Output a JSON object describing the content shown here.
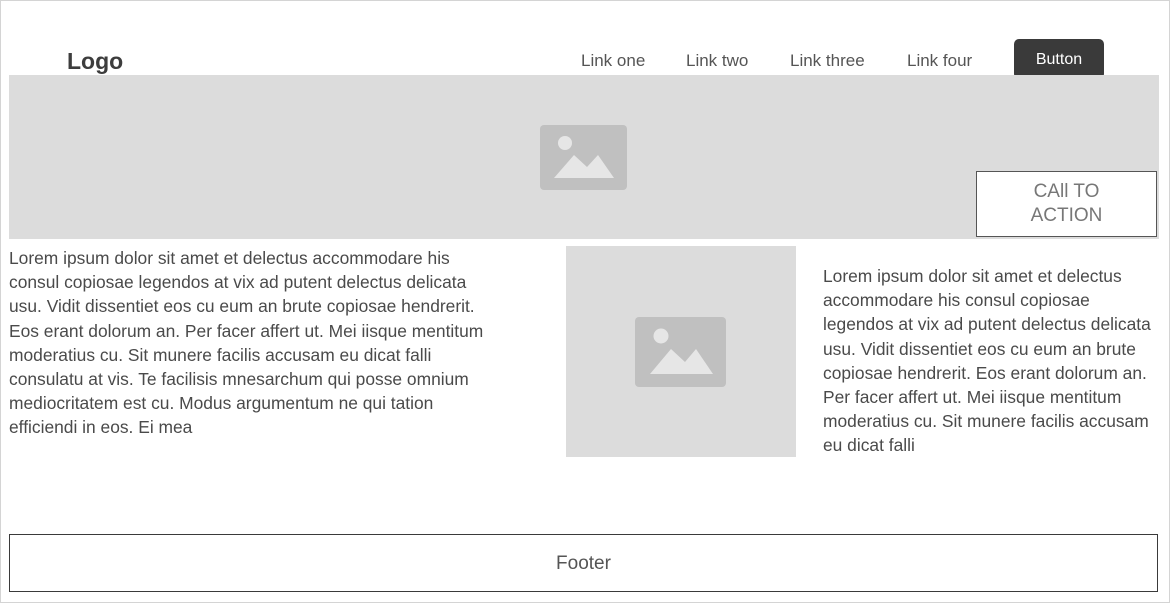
{
  "header": {
    "logo": "Logo",
    "nav": [
      "Link one",
      "Link two",
      "Link three",
      "Link four"
    ],
    "button_label": "Button"
  },
  "hero": {
    "image_icon": "image-placeholder-icon",
    "cta_label": "CAll TO ACTION"
  },
  "content": {
    "left_text": "Lorem ipsum dolor sit amet et delectus accommodare his consul copiosae legendos at vix ad putent delectus delicata usu. Vidit dissentiet eos cu eum an brute copiosae hendrerit. Eos erant dolorum an. Per facer affert ut. Mei iisque mentitum moderatius cu. Sit munere facilis accusam eu dicat falli consulatu at vis. Te facilisis mnesarchum qui posse omnium mediocritatem est cu. Modus argumentum ne qui tation efficiendi in eos. Ei mea",
    "center_image_icon": "image-placeholder-icon",
    "right_text": "Lorem ipsum dolor sit amet et delectus accommodare his consul copiosae legendos at vix ad putent delectus delicata usu. Vidit dissentiet eos cu eum an brute copiosae hendrerit. Eos erant dolorum an. Per facer affert ut. Mei iisque mentitum moderatius cu. Sit munere facilis accusam eu dicat falli"
  },
  "footer": {
    "label": "Footer"
  },
  "colors": {
    "placeholder_bg": "#dcdcdc",
    "placeholder_icon": "#c0c0c0",
    "button_bg": "#3a3a3a"
  }
}
